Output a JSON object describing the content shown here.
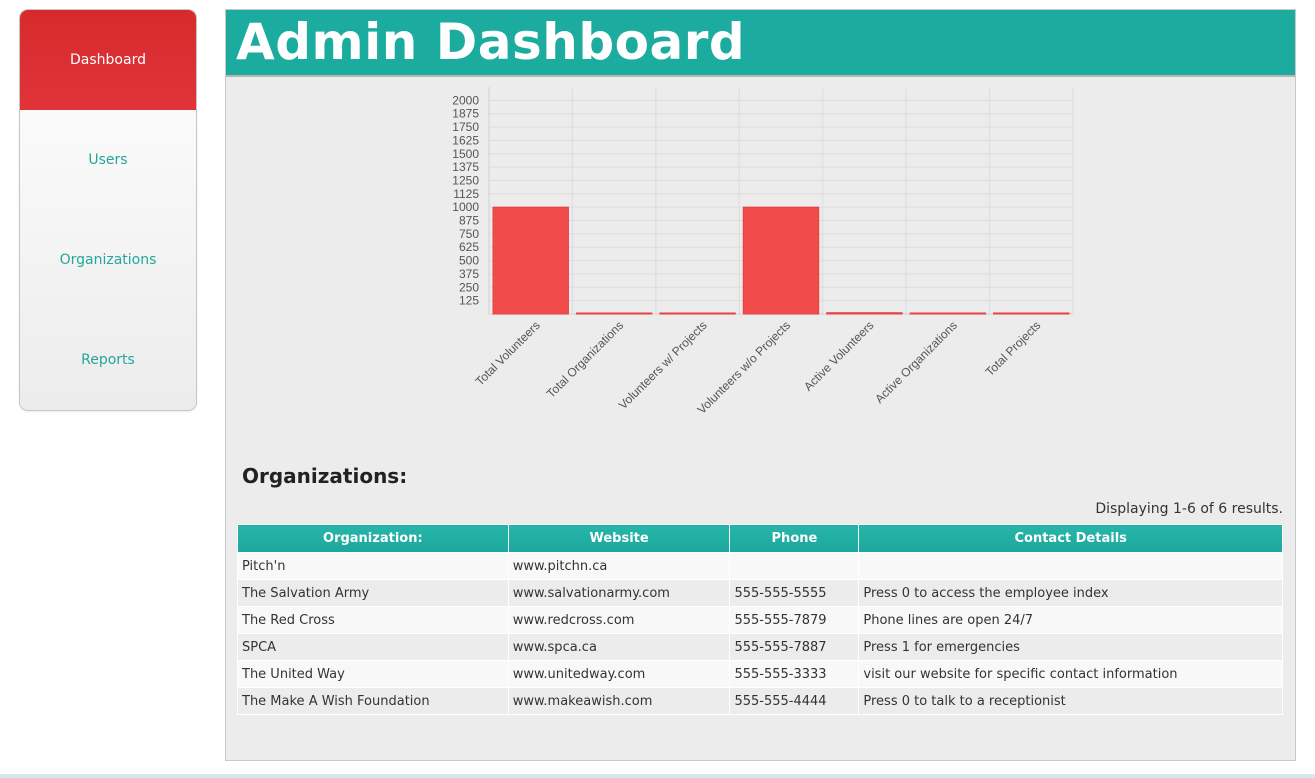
{
  "nav": {
    "items": [
      {
        "label": "Dashboard",
        "active": true
      },
      {
        "label": "Users",
        "active": false
      },
      {
        "label": "Organizations",
        "active": false
      },
      {
        "label": "Reports",
        "active": false
      }
    ]
  },
  "header": {
    "title": "Admin Dashboard"
  },
  "colors": {
    "accent": "#1bab9f",
    "active_nav": "#d72a2c",
    "bar": "#f24b4b",
    "link": "#26a69a"
  },
  "chart_data": {
    "type": "bar",
    "categories": [
      "Total Volunteers",
      "Total Organizations",
      "Volunteers w/ Projects",
      "Volunteers w/o Projects",
      "Active Volunteers",
      "Active Organizations",
      "Total Projects"
    ],
    "values": [
      1000,
      6,
      3,
      1000,
      12,
      6,
      6
    ],
    "ylim": [
      0,
      2125
    ],
    "yticks": [
      125,
      250,
      375,
      500,
      625,
      750,
      875,
      1000,
      1125,
      1250,
      1375,
      1500,
      1625,
      1750,
      1875,
      2000
    ],
    "grid": true
  },
  "organizations": {
    "title": "Organizations:",
    "summary": "Displaying 1-6 of 6 results.",
    "columns": [
      "Organization:",
      "Website",
      "Phone",
      "Contact Details"
    ],
    "rows": [
      [
        "Pitch'n",
        "www.pitchn.ca",
        "",
        ""
      ],
      [
        "The Salvation Army",
        "www.salvationarmy.com",
        "555-555-5555",
        "Press 0 to access the employee index"
      ],
      [
        "The Red Cross",
        "www.redcross.com",
        "555-555-7879",
        "Phone lines are open 24/7"
      ],
      [
        "SPCA",
        "www.spca.ca",
        "555-555-7887",
        "Press 1 for emergencies"
      ],
      [
        "The United Way",
        "www.unitedway.com",
        "555-555-3333",
        "visit our website for specific contact information"
      ],
      [
        "The Make A Wish Foundation",
        "www.makeawish.com",
        "555-555-4444",
        "Press 0 to talk to a receptionist"
      ]
    ]
  }
}
